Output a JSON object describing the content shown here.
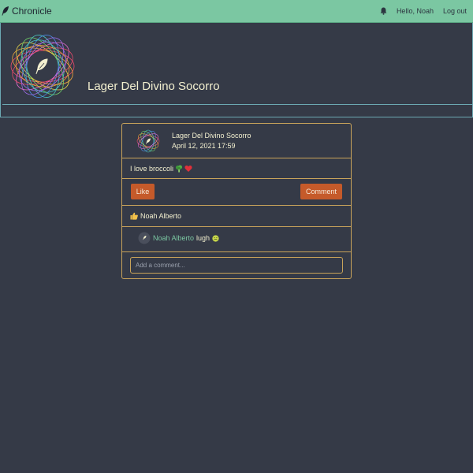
{
  "navbar": {
    "brand": "Chronicle",
    "greeting": "Hello, Noah",
    "logout": "Log out"
  },
  "profile": {
    "name": "Lager Del Divino Socorro"
  },
  "post": {
    "author": "Lager Del Divino Socorro",
    "date": "April 12, 2021 17:59",
    "text": "I love broccoli",
    "text_emojis": [
      "broccoli-emoji",
      "red-heart-emoji"
    ],
    "like_label": "Like",
    "comment_label": "Comment",
    "likes_by": "Noah Alberto",
    "comments": [
      {
        "author": "Noah Alberto",
        "text": "lugh",
        "emoji": "nauseated-face-emoji"
      }
    ],
    "comment_placeholder": "Add a comment..."
  },
  "colors": {
    "background": "#353a47",
    "navbar": "#7bc7a2",
    "card_border": "#c9a35a",
    "button": "#c55a2a",
    "link": "#7bc7a2"
  }
}
